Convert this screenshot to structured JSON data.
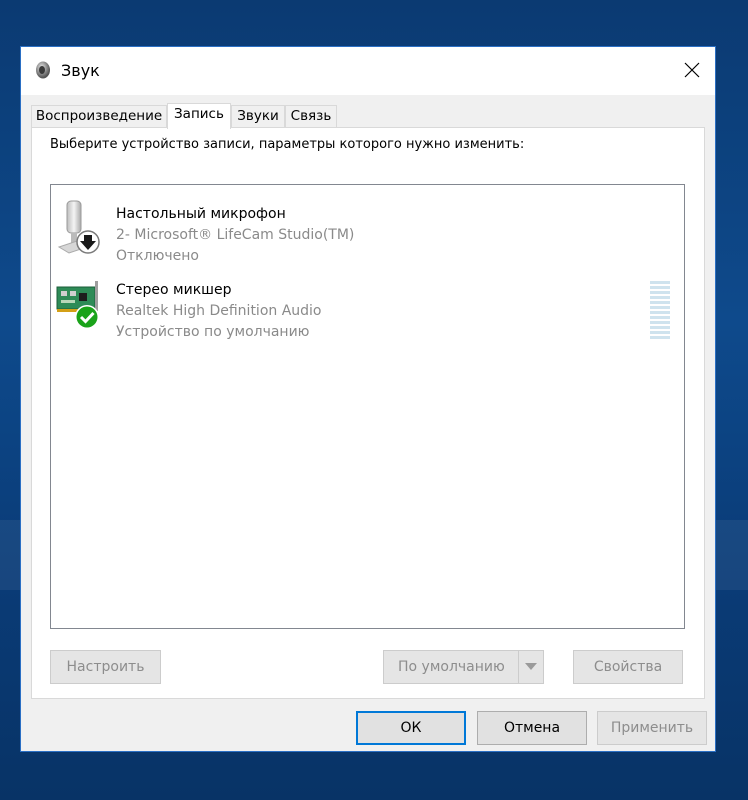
{
  "window": {
    "title": "Звук",
    "icon": "speaker-icon",
    "close_icon": "close-icon"
  },
  "tabs": [
    {
      "label": "Воспроизведение",
      "active": false
    },
    {
      "label": "Запись",
      "active": true
    },
    {
      "label": "Звуки",
      "active": false
    },
    {
      "label": "Связь",
      "active": false
    }
  ],
  "panel": {
    "instructions": "Выберите устройство записи, параметры которого нужно изменить:"
  },
  "devices": [
    {
      "name": "Настольный микрофон",
      "line2": "2- Microsoft® LifeCam Studio(TM)",
      "status": "Отключено",
      "icon": "microphone-icon",
      "badge": "disabled-arrow-icon"
    },
    {
      "name": "Стерео микшер",
      "line2": "Realtek High Definition Audio",
      "status": "Устройство по умолчанию",
      "icon": "soundcard-icon",
      "badge": "default-check-icon"
    }
  ],
  "buttons": {
    "configure": "Настроить",
    "set_default": "По умолчанию",
    "properties": "Свойства",
    "ok": "ОК",
    "cancel": "Отмена",
    "apply": "Применить"
  },
  "colors": {
    "accent": "#0078d7",
    "check_green": "#1aa31a",
    "meter": "#cfe3ee"
  }
}
